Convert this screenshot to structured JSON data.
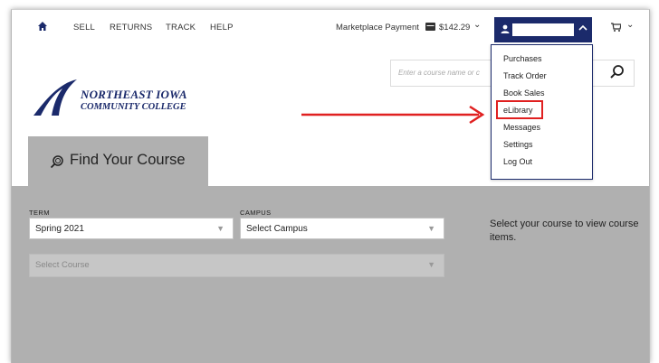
{
  "nav": {
    "home_icon": "home-icon",
    "items": [
      "SELL",
      "RETURNS",
      "TRACK",
      "HELP"
    ],
    "marketplace_label": "Marketplace Payment",
    "marketplace_amount": "$142.29",
    "account_icon": "user-icon",
    "cart_icon": "cart-icon"
  },
  "logo": {
    "line1": "NORTHEAST IOWA",
    "line2": "COMMUNITY COLLEGE"
  },
  "search": {
    "placeholder": "Enter a course name or c"
  },
  "account_menu": {
    "items": [
      "Purchases",
      "Track Order",
      "Book Sales",
      "eLibrary",
      "Messages",
      "Settings",
      "Log Out"
    ],
    "highlighted": "eLibrary"
  },
  "tab": {
    "label": "Find Your Course"
  },
  "form": {
    "term_label": "TERM",
    "term_value": "Spring 2021",
    "campus_label": "CAMPUS",
    "campus_value": "Select Campus",
    "course_value": "Select Course",
    "hint": "Select your course to view course items."
  },
  "colors": {
    "brand_navy": "#1b2a6b",
    "panel_gray": "#b0b0b0",
    "annotation_red": "#e02020"
  }
}
